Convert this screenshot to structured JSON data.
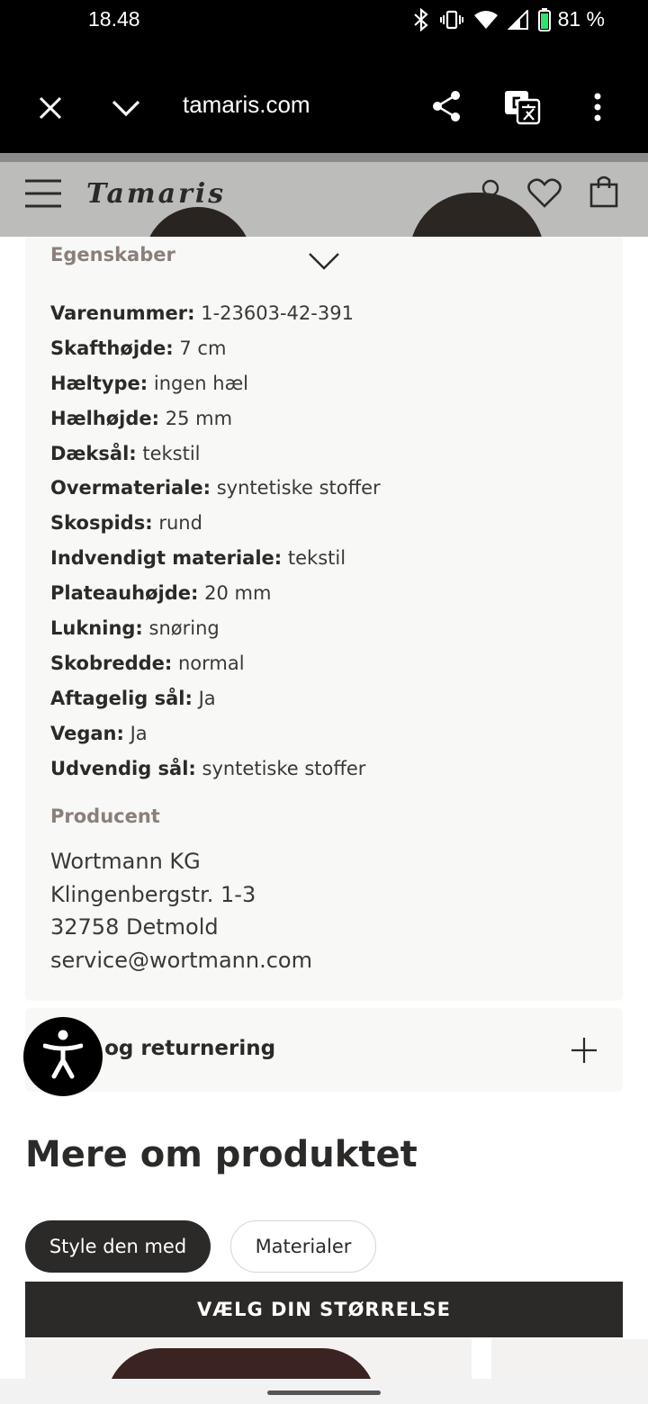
{
  "status_bar": {
    "time": "18.48",
    "battery": "81 %"
  },
  "browser": {
    "url": "tamaris.com",
    "icons": [
      "close-icon",
      "chevron-down-icon",
      "share-icon",
      "translate-icon",
      "more-vert-icon"
    ]
  },
  "site_header": {
    "logo": "Tamaris",
    "icons": [
      "menu-icon",
      "account-icon",
      "heart-icon",
      "bag-icon"
    ]
  },
  "properties": {
    "title": "Egenskaber",
    "items": [
      {
        "key": "Varenummer:",
        "value": "1-23603-42-391"
      },
      {
        "key": "Skafthøjde:",
        "value": "7 cm"
      },
      {
        "key": "Hæltype:",
        "value": "ingen hæl"
      },
      {
        "key": "Hælhøjde:",
        "value": "25 mm"
      },
      {
        "key": "Dæksål:",
        "value": "tekstil"
      },
      {
        "key": "Overmateriale:",
        "value": "syntetiske stoffer"
      },
      {
        "key": "Skospids:",
        "value": "rund"
      },
      {
        "key": "Indvendigt materiale:",
        "value": "tekstil"
      },
      {
        "key": "Plateauhøjde:",
        "value": "20 mm"
      },
      {
        "key": "Lukning:",
        "value": "snøring"
      },
      {
        "key": "Skobredde:",
        "value": "normal"
      },
      {
        "key": "Aftagelig sål:",
        "value": "Ja"
      },
      {
        "key": "Vegan:",
        "value": "Ja"
      },
      {
        "key": "Udvendig sål:",
        "value": "syntetiske stoffer"
      }
    ],
    "producer_title": "Producent",
    "producer_lines": [
      "Wortmann KG",
      "Klingenbergstr. 1-3",
      "32758 Detmold",
      "service@wortmann.com"
    ]
  },
  "delivery": {
    "label": "ring og returnering"
  },
  "more": {
    "heading": "Mere om produktet",
    "tabs": [
      "Style den med",
      "Materialer"
    ]
  },
  "cta": {
    "label": "VÆLG DIN STØRRELSE"
  },
  "colors": {
    "dark": "#2b2a29",
    "panel_bg": "#f8f8f7",
    "muted_title": "#8a7f7a",
    "header_bg": "#bcbcbb"
  }
}
